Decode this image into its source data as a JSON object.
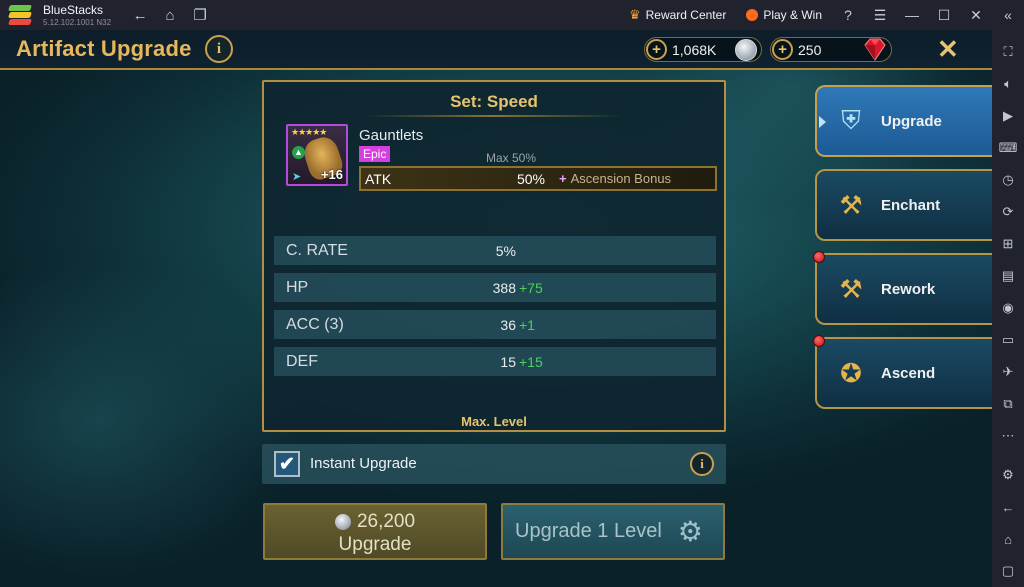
{
  "window": {
    "app_name": "BlueStacks",
    "version": "5.12.102.1001  N32",
    "reward_center": "Reward Center",
    "play_win": "Play & Win"
  },
  "header": {
    "title": "Artifact Upgrade",
    "silver": "1,068K",
    "gems": "250"
  },
  "artifact": {
    "set": "Set: Speed",
    "name": "Gauntlets",
    "rarity": "Epic",
    "level": "+16",
    "stars": "★★★★★",
    "max_label": "Max 50%",
    "main_stat": {
      "label": "ATK",
      "value": "50%",
      "bonus": "Ascension Bonus"
    }
  },
  "substats": [
    {
      "label": "C. RATE",
      "value": "5%",
      "inc": ""
    },
    {
      "label": "HP",
      "value": "388",
      "inc": "+75"
    },
    {
      "label": "ACC (3)",
      "value": "36",
      "inc": "+1"
    },
    {
      "label": "DEF",
      "value": "15",
      "inc": "+15"
    }
  ],
  "max_level_text": "Max. Level",
  "instant_upgrade": {
    "label": "Instant Upgrade",
    "checked": true
  },
  "buttons": {
    "cost": "26,200",
    "upgrade": "Upgrade",
    "upgrade_level": "Upgrade 1 Level"
  },
  "actions": [
    {
      "label": "Upgrade",
      "active": true,
      "icon": "armor-icon"
    },
    {
      "label": "Enchant",
      "active": false,
      "icon": "anvil-icon"
    },
    {
      "label": "Rework",
      "active": false,
      "icon": "hammer-wrench-icon"
    },
    {
      "label": "Ascend",
      "active": false,
      "icon": "helmet-stars-icon"
    }
  ],
  "colors": {
    "accent_gold": "#e6c46e",
    "rarity_epic": "#d53fe0",
    "increase_green": "#4bd05a"
  }
}
